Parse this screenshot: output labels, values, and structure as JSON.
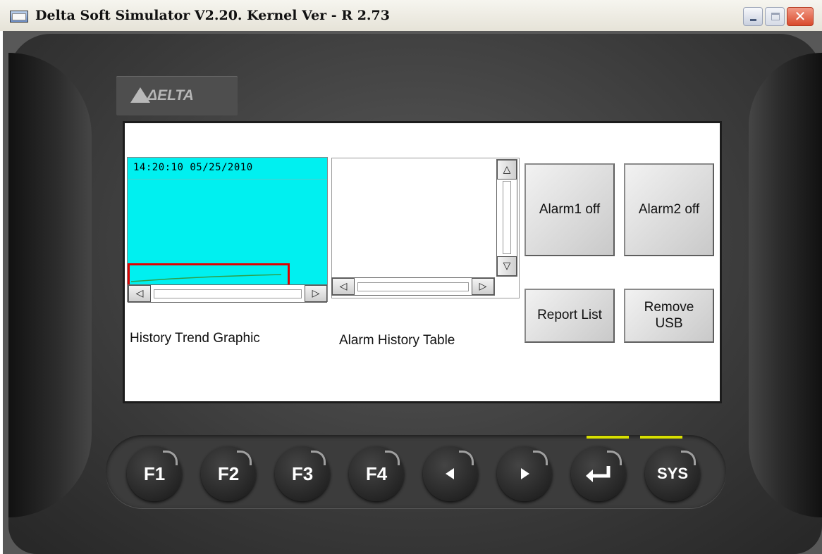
{
  "window": {
    "title": "Delta Soft Simulator V2.20. Kernel Ver - R 2.73"
  },
  "device": {
    "logo_text": "ΔELTA"
  },
  "trend": {
    "timestamp": "14:20:10 05/25/2010",
    "caption": "History Trend Graphic",
    "bg_color": "#00f0f0",
    "line_color": "#2e9f4a"
  },
  "alarm_table": {
    "caption": "Alarm History Table"
  },
  "buttons": {
    "alarm1": "Alarm1 off",
    "alarm2": "Alarm2 off",
    "report": "Report List",
    "remove_usb": "Remove\nUSB"
  },
  "keys": {
    "f1": "F1",
    "f2": "F2",
    "f3": "F3",
    "f4": "F4",
    "sys": "SYS"
  },
  "icons": {
    "left_arrow": "left-arrow-icon",
    "right_arrow": "right-arrow-icon",
    "enter": "enter-icon"
  },
  "colors": {
    "highlight": "#e00000",
    "led": "#d8e000"
  }
}
